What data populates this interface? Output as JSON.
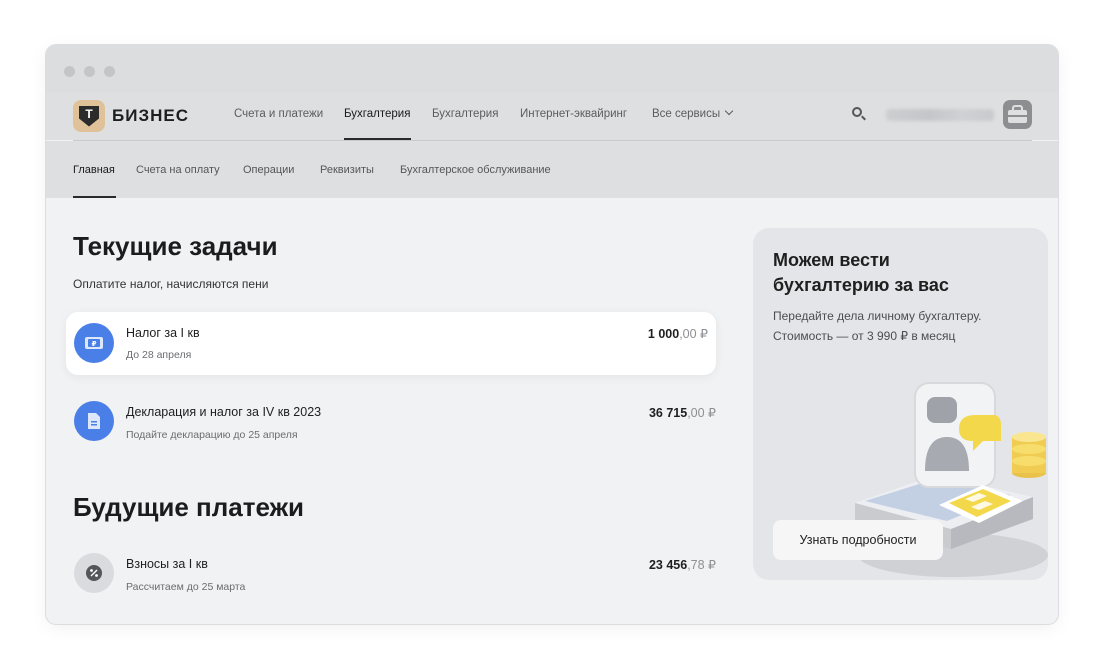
{
  "brand": {
    "logo_letter": "Т",
    "name": "БИЗНЕС"
  },
  "topnav": {
    "items": [
      {
        "label": "Счета и платежи"
      },
      {
        "label": "Бухгалтерия"
      },
      {
        "label": "Бухгалтерия"
      },
      {
        "label": "Интернет-эквайринг"
      },
      {
        "label": "Все сервисы"
      }
    ],
    "active_index": 1
  },
  "subnav": {
    "items": [
      {
        "label": "Главная"
      },
      {
        "label": "Счета на оплату"
      },
      {
        "label": "Операции"
      },
      {
        "label": "Реквизиты"
      },
      {
        "label": "Бухгалтерское обслуживание"
      }
    ],
    "active_index": 0
  },
  "current_tasks": {
    "heading": "Текущие задачи",
    "subtitle": "Оплатите налог, начисляются пени",
    "items": [
      {
        "title": "Налог за I кв",
        "subtitle": "До 28 апреля",
        "amount_main": "1 000",
        "amount_dec": ",00 ₽",
        "icon": "ruble-bill-icon"
      },
      {
        "title": "Декларация и налог за IV кв 2023",
        "subtitle": "Подайте декларацию до 25 апреля",
        "amount_main": "36 715",
        "amount_dec": ",00 ₽",
        "icon": "document-icon"
      }
    ]
  },
  "future_payments": {
    "heading": "Будущие платежи",
    "items": [
      {
        "title": "Взносы за I кв",
        "subtitle": "Рассчитаем до 25 марта",
        "amount_main": "23 456",
        "amount_dec": ",78 ₽",
        "icon": "percent-icon"
      }
    ]
  },
  "promo": {
    "title": "Можем вести бухгалтерию за вас",
    "text": "Передайте дела личному бухгалтеру. Стоимость — от 3 990 ₽ в месяц",
    "button_label": "Узнать подробности"
  },
  "colors": {
    "accent_blue": "#4a7fe8",
    "brand_gold": "#e0c29a",
    "background": "#f1f2f4"
  }
}
